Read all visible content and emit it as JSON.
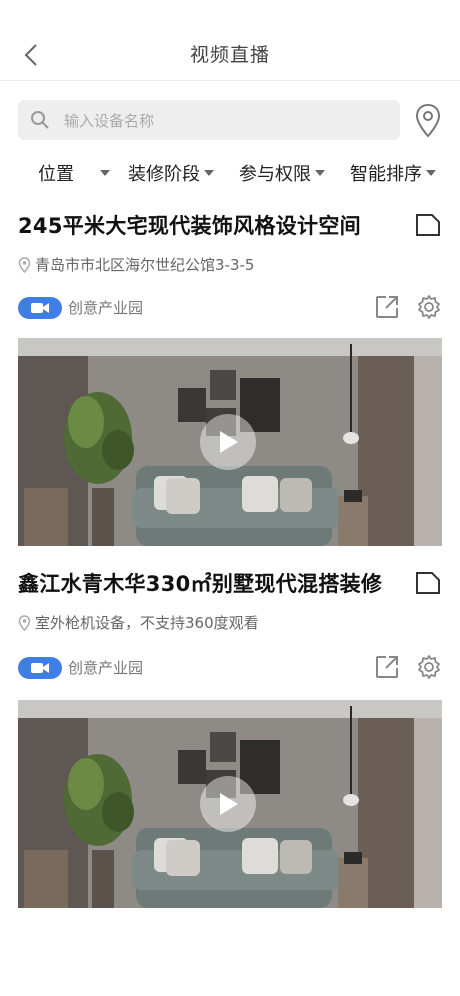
{
  "header": {
    "title": "视频直播",
    "back_icon": "chevron-left-icon"
  },
  "search": {
    "placeholder": "输入设备名称",
    "value": ""
  },
  "filters": [
    {
      "label": "位置"
    },
    {
      "label": "装修阶段"
    },
    {
      "label": "参与权限"
    },
    {
      "label": "智能排序"
    }
  ],
  "cards": [
    {
      "title": "245平米大宅现代装饰风格设计空间",
      "address": "青岛市市北区海尔世纪公馆3-3-5",
      "category": "创意产业园"
    },
    {
      "title": "鑫江水青木华330㎡别墅现代混搭装修",
      "address": "室外枪机设备，不支持360度观看",
      "category": "创意产业园"
    }
  ],
  "colors": {
    "accent": "#3f7fe3",
    "icon_gray": "#777777"
  }
}
